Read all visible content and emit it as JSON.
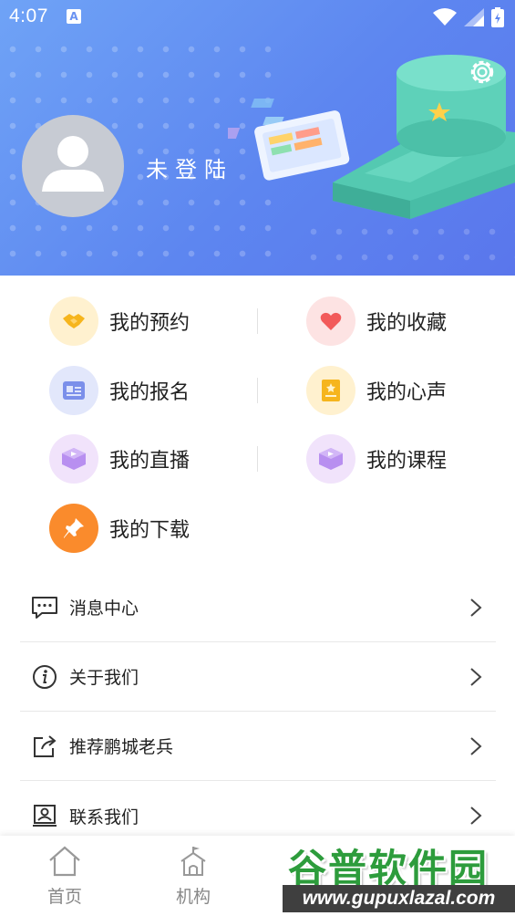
{
  "status_bar": {
    "time": "4:07",
    "notification_letter": "A"
  },
  "profile": {
    "username": "未登陆"
  },
  "grid": {
    "items": [
      {
        "label": "我的预约",
        "icon": "handshake-icon",
        "bg": "#fff1cf"
      },
      {
        "label": "我的收藏",
        "icon": "heart-icon",
        "bg": "#fde3e3"
      },
      {
        "label": "我的报名",
        "icon": "id-card-icon",
        "bg": "#e2e7fb"
      },
      {
        "label": "我的心声",
        "icon": "note-icon",
        "bg": "#fff1cf"
      },
      {
        "label": "我的直播",
        "icon": "play-box-icon",
        "bg": "#f1e3fb"
      },
      {
        "label": "我的课程",
        "icon": "play-box-icon",
        "bg": "#f1e3fb"
      },
      {
        "label": "我的下载",
        "icon": "pin-icon",
        "bg": "#fa8b2c"
      }
    ]
  },
  "list": {
    "items": [
      {
        "label": "消息中心",
        "icon": "message-icon"
      },
      {
        "label": "关于我们",
        "icon": "info-icon"
      },
      {
        "label": "推荐鹏城老兵",
        "icon": "share-icon"
      },
      {
        "label": "联系我们",
        "icon": "contact-card-icon"
      }
    ]
  },
  "bottom_nav": {
    "items": [
      {
        "label": "首页",
        "icon": "home-icon"
      },
      {
        "label": "机构",
        "icon": "building-icon"
      }
    ]
  },
  "watermark": {
    "title": "谷普软件园",
    "url": "www.gupuxlazal.com"
  },
  "colors": {
    "header_start": "#6fa3f6",
    "header_end": "#5a76ec",
    "accent_orange": "#fa8b2c"
  }
}
